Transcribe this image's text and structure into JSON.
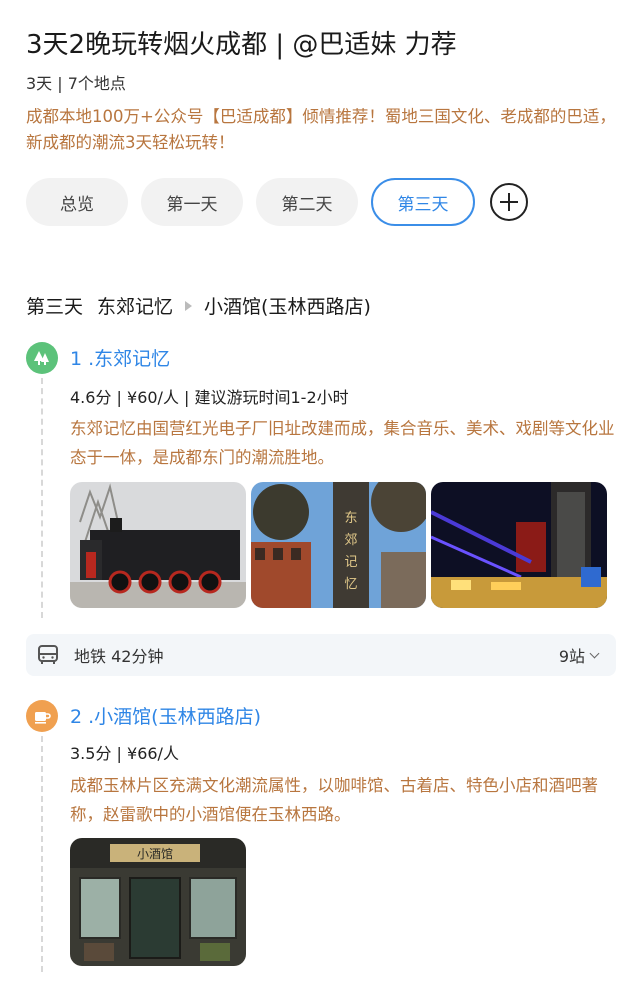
{
  "header": {
    "title": "3天2晚玩转烟火成都 | @巴适妹 力荐",
    "meta": "3天 | 7个地点",
    "description": "成都本地100万+公众号【巴适成都】倾情推荐！蜀地三国文化、老成都的巴适，新成都的潮流3天轻松玩转！"
  },
  "tabs": [
    {
      "label": "总览",
      "active": false
    },
    {
      "label": "第一天",
      "active": false
    },
    {
      "label": "第二天",
      "active": false
    },
    {
      "label": "第三天",
      "active": true
    }
  ],
  "route": {
    "day": "第三天",
    "from": "东郊记忆",
    "to": "小酒馆(玉林西路店)"
  },
  "pois": [
    {
      "name": "1 .东郊记忆",
      "icon": "tree-icon",
      "stats": "4.6分 | ¥60/人 | 建议游玩时间1-2小时",
      "description": "东郊记忆由国营红光电子厂旧址改建而成，集合音乐、美术、戏剧等文化业态于一体，是成都东门的潮流胜地。"
    },
    {
      "name": "2 .小酒馆(玉林西路店)",
      "icon": "coffee-cup-icon",
      "stats": "3.5分 | ¥66/人",
      "description": "成都玉林片区充满文化潮流属性，以咖啡馆、古着店、特色小店和酒吧著称，赵雷歌中的小酒馆便在玉林西路。"
    }
  ],
  "transit": {
    "mode": "地铁 42分钟",
    "stops": "9站",
    "icon": "bus-icon"
  },
  "photos": {
    "sign_text": "东郊记忆",
    "bar_sign": "小酒馆"
  },
  "colors": {
    "accent": "#2f86e6",
    "desc": "#b8763f",
    "green_icon": "#5cc27a",
    "orange_icon": "#f0a050"
  }
}
